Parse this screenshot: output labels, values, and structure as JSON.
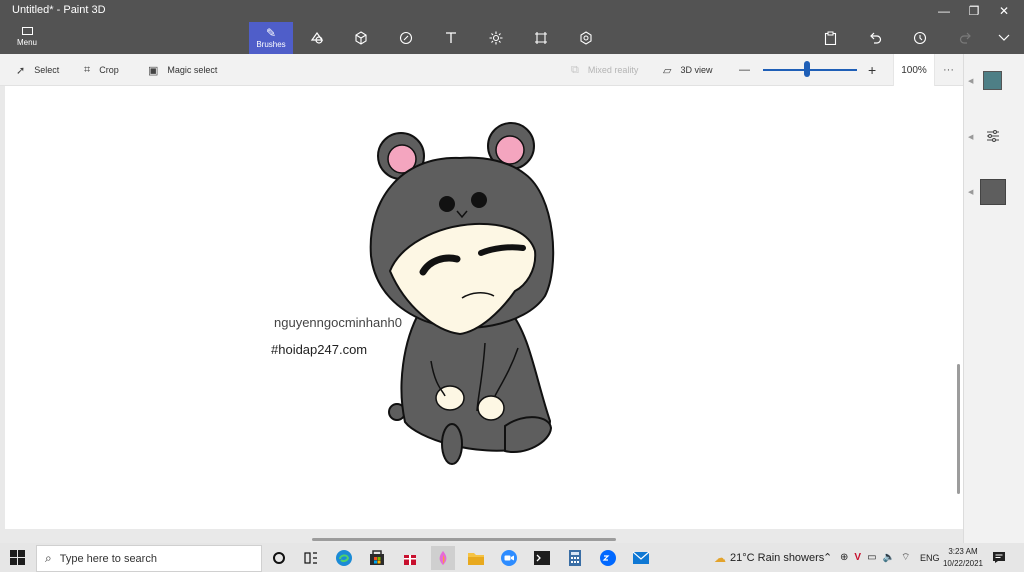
{
  "app": {
    "title": "Untitled* - Paint 3D"
  },
  "window_controls": {
    "minimize": "—",
    "maximize": "❐",
    "close": "✕"
  },
  "ribbon": {
    "menu_label": "Menu",
    "active_tool_label": "Brushes",
    "tools": [
      {
        "name": "2d-shapes",
        "icon": "shapes-icon"
      },
      {
        "name": "3d-shapes",
        "icon": "cube-icon"
      },
      {
        "name": "stickers",
        "icon": "sticker-icon"
      },
      {
        "name": "text",
        "icon": "text-icon"
      },
      {
        "name": "effects",
        "icon": "effects-icon"
      },
      {
        "name": "canvas",
        "icon": "canvas-icon"
      },
      {
        "name": "3d-library",
        "icon": "3d-library-icon"
      }
    ],
    "right_tools": [
      {
        "name": "paste",
        "icon": "paste-icon"
      },
      {
        "name": "undo",
        "icon": "undo-icon"
      },
      {
        "name": "history",
        "icon": "history-icon"
      },
      {
        "name": "redo",
        "icon": "redo-icon"
      },
      {
        "name": "expand",
        "icon": "chevron-down-icon"
      }
    ]
  },
  "subtoolbar": {
    "select": "Select",
    "crop": "Crop",
    "magic_select": "Magic select",
    "mixed_reality": "Mixed reality",
    "view_3d": "3D view",
    "zoom_minus": "—",
    "zoom_plus": "+",
    "zoom_value": "100%",
    "zoom_fraction": 0.47,
    "more": "···"
  },
  "canvas": {
    "text_line_1": "nguyenngocminhanh0",
    "text_line_2": "#hoidap247.com"
  },
  "taskbar": {
    "search_placeholder": "Type here to search",
    "weather": "21°C  Rain showers",
    "language": "ENG",
    "time": "3:23 AM",
    "date": "10/22/2021",
    "app_icons": [
      "cortana-icon",
      "task-view-icon",
      "edge-icon",
      "store-icon",
      "gift-icon",
      "paint3d-icon",
      "file-explorer-icon",
      "zoom-icon",
      "terminal-icon",
      "calculator-icon",
      "zalo-icon",
      "mail-icon"
    ]
  },
  "colors": {
    "titlebar": "#535353",
    "accent": "#4f5ec9",
    "hood_gray": "#5e5e5e",
    "ear_pink": "#f4a5bf",
    "face_cream": "#fdf7e4"
  }
}
